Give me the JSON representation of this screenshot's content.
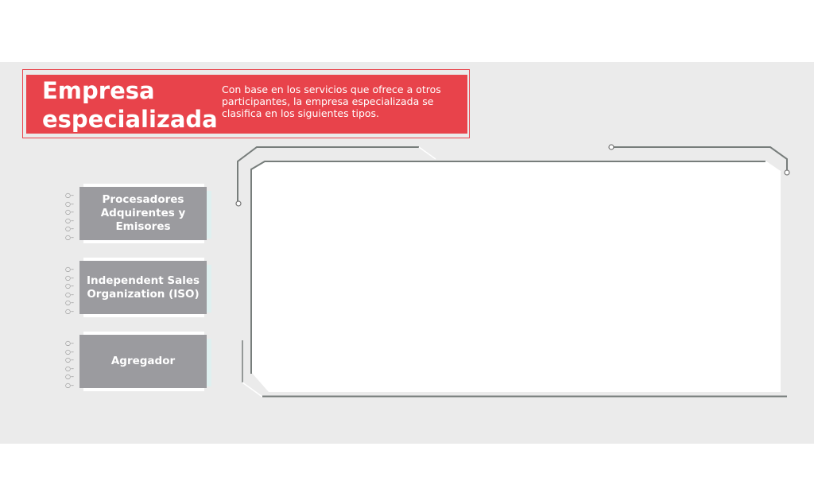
{
  "header": {
    "title": "Empresa especializada",
    "description": "Con base en los servicios que ofrece a otros participantes, la empresa especializada se clasifica en los siguientes tipos.",
    "accent_color": "#e8434b"
  },
  "categories": [
    {
      "label": "Procesadores Adquirentes y Emisores"
    },
    {
      "label": "Independent Sales Organization (ISO)"
    },
    {
      "label": "Agregador"
    }
  ],
  "card_color": "#9b9b9f",
  "content_panel": {
    "text": ""
  }
}
